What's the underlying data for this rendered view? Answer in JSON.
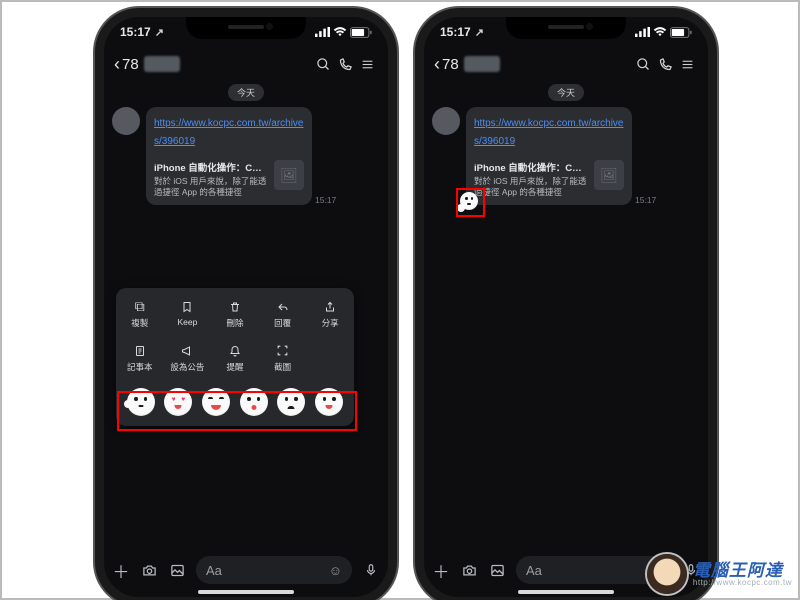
{
  "status": {
    "time": "15:17"
  },
  "header": {
    "back_count": "78"
  },
  "date_pill": "今天",
  "message": {
    "link_text": "https://www.kocpc.com.tw/archives/396019",
    "preview_title": "iPhone 自動化操作：C…",
    "preview_desc": "對於 iOS 用戶來說，除了能透過捷徑 App 的各種捷徑",
    "timestamp": "15:17"
  },
  "menu": {
    "row1": [
      {
        "icon": "⧉",
        "label": "複製"
      },
      {
        "icon": "⟁",
        "label": "Keep"
      },
      {
        "icon": "🗑",
        "label": "刪除"
      },
      {
        "icon": "↶",
        "label": "回覆"
      },
      {
        "icon": "⇪",
        "label": "分享"
      }
    ],
    "row2": [
      {
        "icon": "🗒",
        "label": "記事本"
      },
      {
        "icon": "📣",
        "label": "設為公告"
      },
      {
        "icon": "🔔",
        "label": "提醒"
      },
      {
        "icon": "⛶",
        "label": "截圖"
      }
    ]
  },
  "input": {
    "placeholder": "Aa"
  },
  "watermark": {
    "title": "電腦王阿達",
    "url": "http://www.kocpc.com.tw"
  }
}
